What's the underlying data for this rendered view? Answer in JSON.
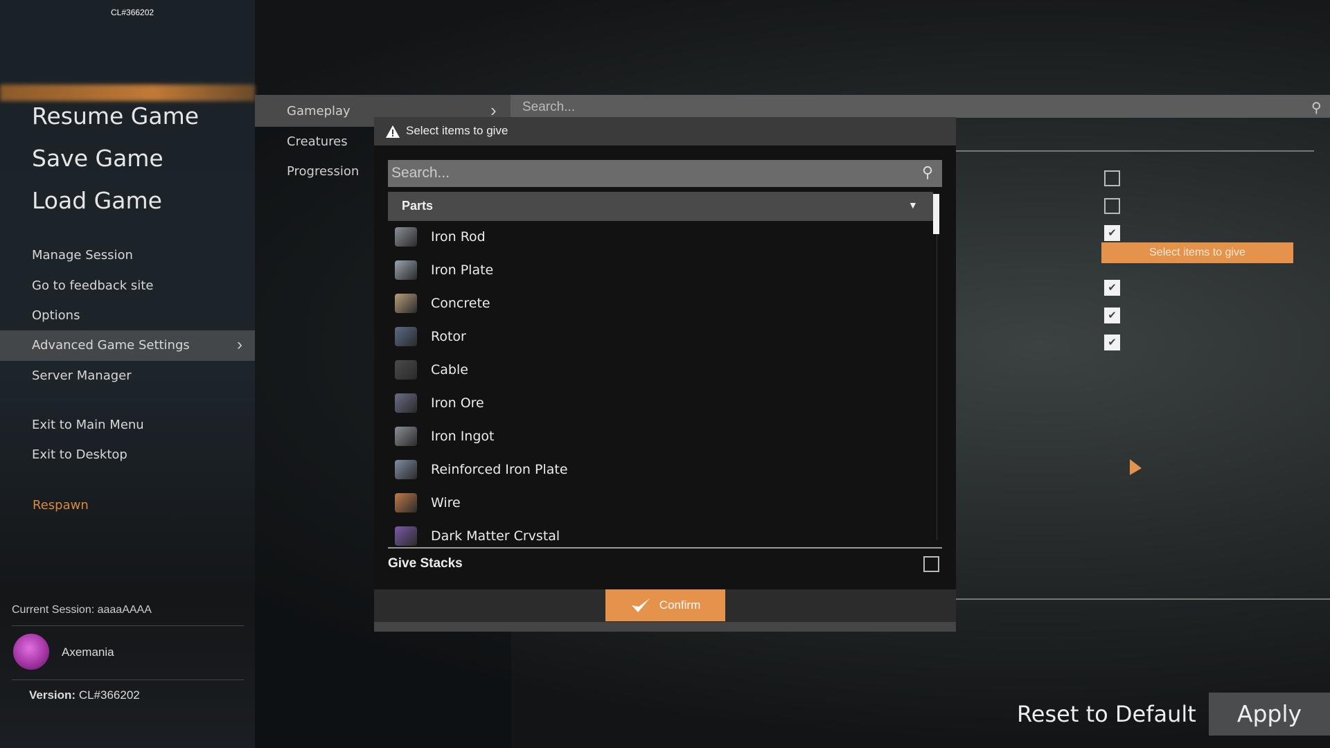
{
  "build_label": "CL#366202",
  "menu": {
    "primary": [
      "Resume Game",
      "Save Game",
      "Load Game"
    ],
    "secondary": [
      "Manage Session",
      "Go to feedback site",
      "Options",
      "Advanced Game Settings",
      "Server Manager"
    ],
    "exit": [
      "Exit to Main Menu",
      "Exit to Desktop"
    ],
    "respawn": "Respawn"
  },
  "session": {
    "label": "Current Session: aaaaAAAA",
    "user": "Axemania",
    "version_label": "Version:",
    "version": "CL#366202"
  },
  "settings_tabs": [
    "Gameplay",
    "Creatures",
    "Progression"
  ],
  "settings_search_placeholder": "Search...",
  "modal": {
    "title": "Select items to give",
    "search_placeholder": "Search...",
    "category": "Parts",
    "items": [
      {
        "name": "Iron Rod",
        "color": "#8a8f96"
      },
      {
        "name": "Iron Plate",
        "color": "#9aa3ad"
      },
      {
        "name": "Concrete",
        "color": "#b89d7a"
      },
      {
        "name": "Rotor",
        "color": "#5a6b88"
      },
      {
        "name": "Cable",
        "color": "#4a4a4a"
      },
      {
        "name": "Iron Ore",
        "color": "#6b6b88"
      },
      {
        "name": "Iron Ingot",
        "color": "#8a8f96"
      },
      {
        "name": "Reinforced Iron Plate",
        "color": "#7d8da0"
      },
      {
        "name": "Wire",
        "color": "#c07a48"
      },
      {
        "name": "Dark Matter Crvstal",
        "color": "#7a5aa8"
      }
    ],
    "give_stacks": "Give Stacks",
    "give_stacks_checked": false,
    "confirm": "Confirm"
  },
  "right_panel": {
    "checkboxes": [
      false,
      false,
      true,
      true,
      true,
      true
    ],
    "button": "Select items to give"
  },
  "footer": {
    "reset": "Reset to Default",
    "apply": "Apply"
  },
  "colors": {
    "accent": "#e5924a",
    "respawn": "#d98a3e"
  }
}
